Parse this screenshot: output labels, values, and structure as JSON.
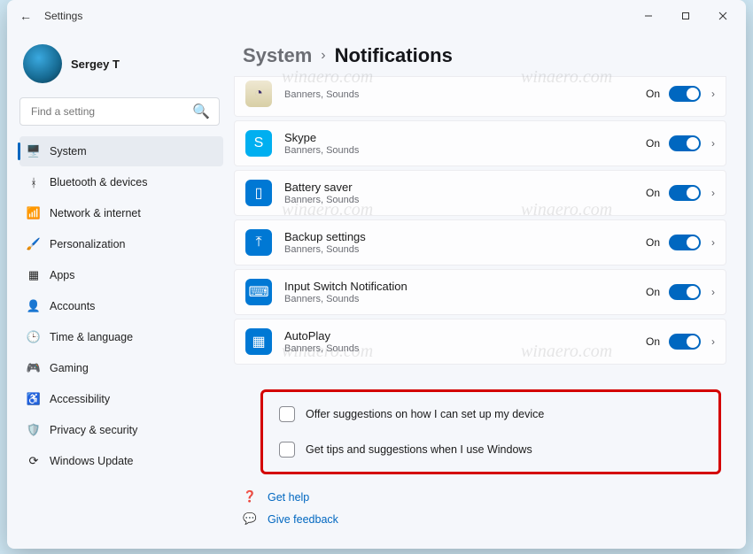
{
  "window": {
    "title": "Settings"
  },
  "profile": {
    "name": "Sergey T"
  },
  "search": {
    "placeholder": "Find a setting"
  },
  "sidebar": {
    "items": [
      {
        "label": "System",
        "icon": "🖥️",
        "active": true
      },
      {
        "label": "Bluetooth & devices",
        "icon": "ᚼ"
      },
      {
        "label": "Network & internet",
        "icon": "📶"
      },
      {
        "label": "Personalization",
        "icon": "🖌️"
      },
      {
        "label": "Apps",
        "icon": "▦"
      },
      {
        "label": "Accounts",
        "icon": "👤"
      },
      {
        "label": "Time & language",
        "icon": "🕒"
      },
      {
        "label": "Gaming",
        "icon": "🎮"
      },
      {
        "label": "Accessibility",
        "icon": "♿"
      },
      {
        "label": "Privacy & security",
        "icon": "🛡️"
      },
      {
        "label": "Windows Update",
        "icon": "⟳"
      }
    ]
  },
  "breadcrumb": {
    "root": "System",
    "sep": "›",
    "leaf": "Notifications"
  },
  "apps": [
    {
      "title": "",
      "sub": "Banners, Sounds",
      "state": "On",
      "iconClass": "icon-eclipse",
      "glyph": "◔"
    },
    {
      "title": "Skype",
      "sub": "Banners, Sounds",
      "state": "On",
      "iconClass": "icon-skype",
      "glyph": "S"
    },
    {
      "title": "Battery saver",
      "sub": "Banners, Sounds",
      "state": "On",
      "iconClass": "icon-battery",
      "glyph": "▯"
    },
    {
      "title": "Backup settings",
      "sub": "Banners, Sounds",
      "state": "On",
      "iconClass": "icon-backup",
      "glyph": "⤒"
    },
    {
      "title": "Input Switch Notification",
      "sub": "Banners, Sounds",
      "state": "On",
      "iconClass": "icon-input",
      "glyph": "⌨"
    },
    {
      "title": "AutoPlay",
      "sub": "Banners, Sounds",
      "state": "On",
      "iconClass": "icon-autoplay",
      "glyph": "▦"
    }
  ],
  "checkboxes": {
    "setup": "Offer suggestions on how I can set up my device",
    "tips": "Get tips and suggestions when I use Windows"
  },
  "footer": {
    "help": "Get help",
    "feedback": "Give feedback"
  },
  "watermark": "winaero.com"
}
